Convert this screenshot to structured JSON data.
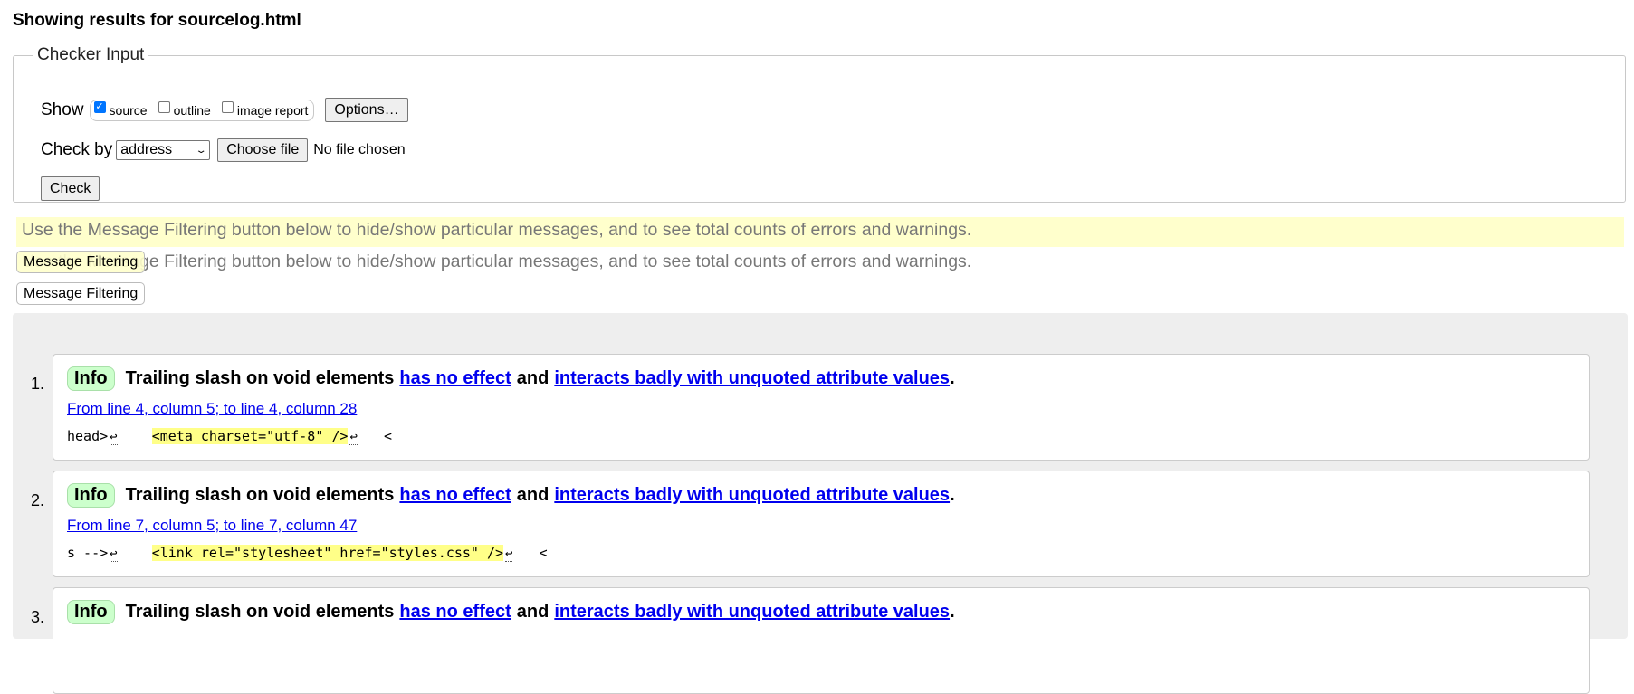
{
  "page_title": "Showing results for sourcelog.html",
  "checker": {
    "legend": "Checker Input",
    "show_label": "Show",
    "show_options": [
      {
        "label": "source",
        "checked": true
      },
      {
        "label": "outline",
        "checked": false
      },
      {
        "label": "image report",
        "checked": false
      }
    ],
    "options_button": "Options…",
    "check_by_label": "Check by",
    "check_by_value": "address",
    "choose_file_button": "Choose file",
    "no_file_text": "No file chosen",
    "check_button": "Check"
  },
  "filter_hint": "Use the Message Filtering button below to hide/show particular messages, and to see total counts of errors and warnings.",
  "filter_button": "Message Filtering",
  "messages": [
    {
      "number": "1.",
      "type": "Info",
      "text_start": "Trailing slash on void elements",
      "link1": "has no effect",
      "text_mid": "and",
      "link2": "interacts badly with unquoted attribute values",
      "text_end": ".",
      "location": "From line 4, column 5; to line 4, column 28",
      "code_before": "head>",
      "code_lf": "↩",
      "code_ws": "    ",
      "code_highlight": "<meta charset=\"utf-8\" />",
      "code_after": "   <"
    },
    {
      "number": "2.",
      "type": "Info",
      "text_start": "Trailing slash on void elements",
      "link1": "has no effect",
      "text_mid": "and",
      "link2": "interacts badly with unquoted attribute values",
      "text_end": ".",
      "location": "From line 7, column 5; to line 7, column 47",
      "code_before": "s -->",
      "code_lf": "↩",
      "code_ws": "    ",
      "code_highlight": "<link rel=\"stylesheet\" href=\"styles.css\" />",
      "code_after": "   <"
    },
    {
      "number": "3.",
      "type": "Info",
      "text_start": "Trailing slash on void elements",
      "link1": "has no effect",
      "text_mid": "and",
      "link2": "interacts badly with unquoted attribute values",
      "text_end": "."
    }
  ],
  "colors": {
    "hint_bg": "#ffffcc",
    "info_badge_bg": "#ccffcc",
    "code_highlight": "#ffff88",
    "link": "#0000ee",
    "results_bg": "#eeeeee"
  }
}
